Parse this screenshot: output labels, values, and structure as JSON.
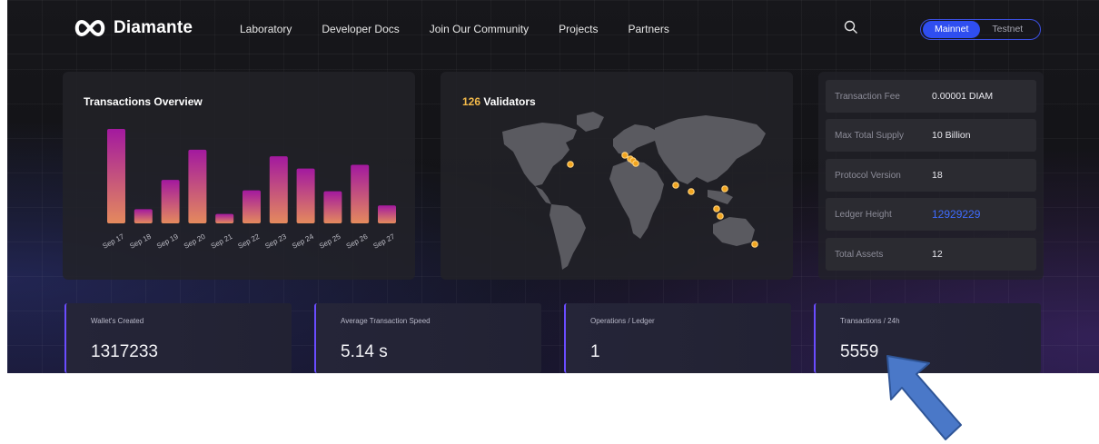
{
  "brand": {
    "name": "Diamante"
  },
  "nav": [
    "Laboratory",
    "Developer Docs",
    "Join Our Community",
    "Projects",
    "Partners"
  ],
  "network_toggle": {
    "options": [
      "Mainnet",
      "Testnet"
    ],
    "selected": "Mainnet"
  },
  "tx_overview": {
    "title": "Transactions Overview"
  },
  "chart_data": {
    "type": "bar",
    "title": "Transactions Overview",
    "categories": [
      "Sep 17",
      "Sep 18",
      "Sep 19",
      "Sep 20",
      "Sep 21",
      "Sep 22",
      "Sep 23",
      "Sep 24",
      "Sep 25",
      "Sep 26",
      "Sep 27"
    ],
    "values": [
      100,
      15,
      46,
      78,
      10,
      35,
      71,
      58,
      34,
      62,
      19
    ],
    "bar_gradient": [
      "#a3199f",
      "#e48a5d"
    ]
  },
  "validators": {
    "count": "126",
    "label": "Validators"
  },
  "stats": [
    {
      "label": "Transaction Fee",
      "value": "0.00001 DIAM"
    },
    {
      "label": "Max Total Supply",
      "value": "10 Billion"
    },
    {
      "label": "Protocol Version",
      "value": "18"
    },
    {
      "label": "Ledger Height",
      "value": "12929229"
    },
    {
      "label": "Total Assets",
      "value": "12"
    }
  ],
  "metrics": [
    {
      "label": "Wallet's Created",
      "value": "1317233"
    },
    {
      "label": "Average Transaction Speed",
      "value": "5.14 s"
    },
    {
      "label": "Operations / Ledger",
      "value": "1"
    },
    {
      "label": "Transactions / 24h",
      "value": "5559"
    }
  ],
  "colors": {
    "accent": "#2f4ef0",
    "validator_dot": "#f2a51f",
    "link": "#3f6cff"
  },
  "icons": {
    "logo": "infinity-icon",
    "search": "search-icon",
    "annotation": "arrow-pointer-icon"
  }
}
